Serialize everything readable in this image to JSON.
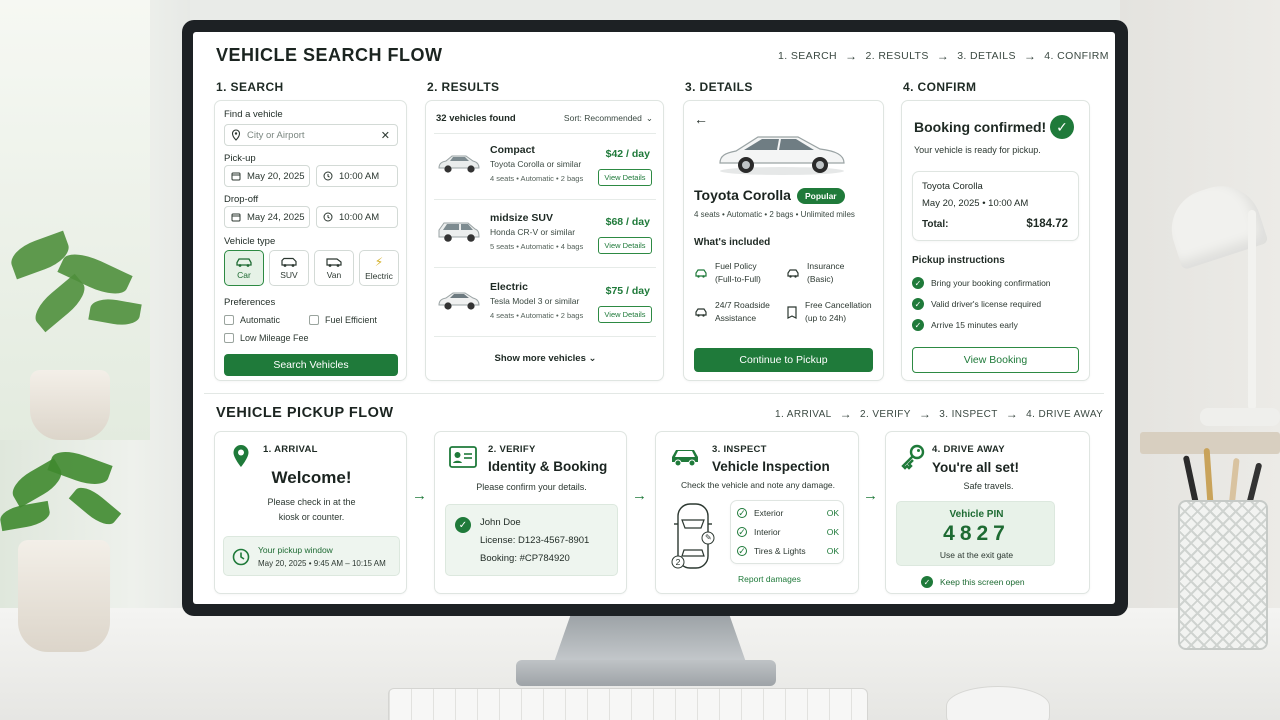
{
  "search_flow": {
    "title": "VEHICLE SEARCH FLOW",
    "steps": [
      "1. SEARCH",
      "2. RESULTS",
      "3. DETAILS",
      "4. CONFIRM"
    ]
  },
  "search": {
    "heading": "1. SEARCH",
    "find_label": "Find a vehicle",
    "location_placeholder": "City or Airport",
    "pickup_label": "Pick-up",
    "pickup_date": "May 20, 2025",
    "pickup_time": "10:00 AM",
    "dropoff_label": "Drop-off",
    "dropoff_date": "May 24, 2025",
    "dropoff_time": "10:00 AM",
    "vehicle_type_label": "Vehicle type",
    "vehicle_types": [
      "Car",
      "SUV",
      "Van",
      "Electric"
    ],
    "selected_type": "Car",
    "preferences_label": "Preferences",
    "preferences": [
      "Automatic",
      "Fuel Efficient",
      "Low Mileage Fee"
    ],
    "button": "Search Vehicles"
  },
  "results": {
    "heading": "2. RESULTS",
    "count": "32 vehicles found",
    "sort": "Sort: Recommended",
    "items": [
      {
        "name": "Compact",
        "model": "Toyota Corolla or similar",
        "specs": "4 seats • Automatic • 2 bags",
        "price": "$42 / day",
        "button": "View Details"
      },
      {
        "name": "midsize SUV",
        "model": "Honda CR-V or similar",
        "specs": "5 seats • Automatic • 4 bags",
        "price": "$68 / day",
        "button": "View Details"
      },
      {
        "name": "Electric",
        "model": "Tesla Model 3 or similar",
        "specs": "4 seats • Automatic • 2 bags",
        "price": "$75 / day",
        "button": "View Details"
      }
    ],
    "show_more": "Show more vehicles"
  },
  "details": {
    "heading": "3. DETAILS",
    "car_name": "Toyota Corolla",
    "badge": "Popular",
    "specs": "4 seats • Automatic • 2 bags • Unlimited miles",
    "included_label": "What's included",
    "features": [
      {
        "icon": "fuel-icon",
        "line1": "Fuel Policy",
        "line2": "(Full-to-Full)"
      },
      {
        "icon": "insurance-icon",
        "line1": "Insurance",
        "line2": "(Basic)"
      },
      {
        "icon": "roadside-icon",
        "line1": "24/7 Roadside",
        "line2": "Assistance"
      },
      {
        "icon": "cancel-icon",
        "line1": "Free Cancellation",
        "line2": "(up to 24h)"
      }
    ],
    "button": "Continue to Pickup"
  },
  "confirm": {
    "heading": "4. CONFIRM",
    "title": "Booking confirmed!",
    "subtitle": "Your vehicle is ready for pickup.",
    "car": "Toyota Corolla",
    "datetime": "May 20, 2025 • 10:00 AM",
    "total_label": "Total:",
    "total_value": "$184.72",
    "instructions_label": "Pickup instructions",
    "instructions": [
      "Bring your booking confirmation",
      "Valid driver's license required",
      "Arrive 15 minutes early"
    ],
    "button": "View Booking"
  },
  "pickup_flow": {
    "title": "VEHICLE PICKUP FLOW",
    "steps": [
      "1. ARRIVAL",
      "2. VERIFY",
      "3. INSPECT",
      "4. DRIVE AWAY"
    ]
  },
  "arrival": {
    "step": "1. ARRIVAL",
    "title": "Welcome!",
    "text1": "Please check in at the",
    "text2": "kiosk or counter.",
    "window_label": "Your pickup window",
    "window_value": "May 20, 2025 • 9:45 AM – 10:15 AM"
  },
  "verify": {
    "step": "2. VERIFY",
    "title": "Identity & Booking",
    "text": "Please confirm your details.",
    "name": "John Doe",
    "license": "License: D123-4567-8901",
    "booking": "Booking: #CP784920"
  },
  "inspect": {
    "step": "3. INSPECT",
    "title": "Vehicle Inspection",
    "text": "Check the vehicle and note any damage.",
    "checks": [
      {
        "label": "Exterior",
        "status": "OK"
      },
      {
        "label": "Interior",
        "status": "OK"
      },
      {
        "label": "Tires & Lights",
        "status": "OK"
      }
    ],
    "marker1": "2",
    "link": "Report damages"
  },
  "drive": {
    "step": "4. DRIVE AWAY",
    "title": "You're all set!",
    "text": "Safe travels.",
    "pin_label": "Vehicle PIN",
    "pin": "4827",
    "pin_note": "Use at the exit gate",
    "keep": "Keep this screen open"
  },
  "colors": {
    "accent": "#1f7a3a",
    "accent_light": "#e6f2e7",
    "text": "#1e2a24"
  }
}
